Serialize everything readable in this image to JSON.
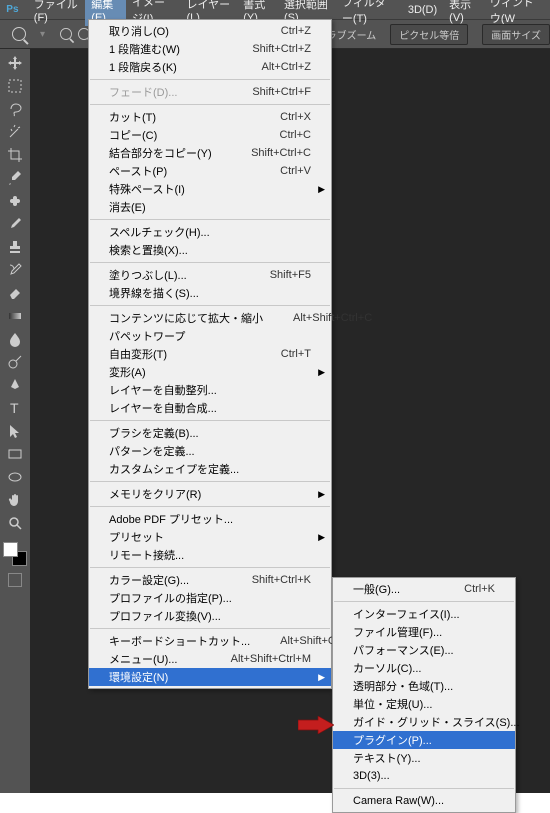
{
  "menubar": {
    "items": [
      "ファイル(F)",
      "編集(E)",
      "イメージ(I)",
      "レイヤー(L)",
      "書式(Y)",
      "選択範囲(S)",
      "フィルター(T)",
      "3D(D)",
      "表示(V)",
      "ウィンドウ(W"
    ]
  },
  "optionsbar": {
    "scrub_zoom": "スクラブズーム",
    "pixel_actual": "ピクセル等倍",
    "fit_screen": "画面サイズ"
  },
  "edit_menu": [
    {
      "label": "取り消し(O)",
      "accel": "Ctrl+Z"
    },
    {
      "label": "1 段階進む(W)",
      "accel": "Shift+Ctrl+Z"
    },
    {
      "label": "1 段階戻る(K)",
      "accel": "Alt+Ctrl+Z"
    },
    "sep",
    {
      "label": "フェード(D)...",
      "accel": "Shift+Ctrl+F",
      "disabled": true
    },
    "sep",
    {
      "label": "カット(T)",
      "accel": "Ctrl+X"
    },
    {
      "label": "コピー(C)",
      "accel": "Ctrl+C"
    },
    {
      "label": "結合部分をコピー(Y)",
      "accel": "Shift+Ctrl+C"
    },
    {
      "label": "ペースト(P)",
      "accel": "Ctrl+V"
    },
    {
      "label": "特殊ペースト(I)",
      "sub": true
    },
    {
      "label": "消去(E)"
    },
    "sep",
    {
      "label": "スペルチェック(H)..."
    },
    {
      "label": "検索と置換(X)..."
    },
    "sep",
    {
      "label": "塗りつぶし(L)...",
      "accel": "Shift+F5"
    },
    {
      "label": "境界線を描く(S)..."
    },
    "sep",
    {
      "label": "コンテンツに応じて拡大・縮小",
      "accel": "Alt+Shift+Ctrl+C"
    },
    {
      "label": "パペットワープ"
    },
    {
      "label": "自由変形(T)",
      "accel": "Ctrl+T"
    },
    {
      "label": "変形(A)",
      "sub": true
    },
    {
      "label": "レイヤーを自動整列..."
    },
    {
      "label": "レイヤーを自動合成..."
    },
    "sep",
    {
      "label": "ブラシを定義(B)..."
    },
    {
      "label": "パターンを定義..."
    },
    {
      "label": "カスタムシェイプを定義..."
    },
    "sep",
    {
      "label": "メモリをクリア(R)",
      "sub": true
    },
    "sep",
    {
      "label": "Adobe PDF プリセット..."
    },
    {
      "label": "プリセット",
      "sub": true
    },
    {
      "label": "リモート接続..."
    },
    "sep",
    {
      "label": "カラー設定(G)...",
      "accel": "Shift+Ctrl+K"
    },
    {
      "label": "プロファイルの指定(P)..."
    },
    {
      "label": "プロファイル変換(V)..."
    },
    "sep",
    {
      "label": "キーボードショートカット...",
      "accel": "Alt+Shift+Ctrl+K"
    },
    {
      "label": "メニュー(U)...",
      "accel": "Alt+Shift+Ctrl+M"
    },
    {
      "label": "環境設定(N)",
      "sub": true,
      "highlight": true
    }
  ],
  "prefs_menu": [
    {
      "label": "一般(G)...",
      "accel": "Ctrl+K"
    },
    "sep",
    {
      "label": "インターフェイス(I)..."
    },
    {
      "label": "ファイル管理(F)..."
    },
    {
      "label": "パフォーマンス(E)..."
    },
    {
      "label": "カーソル(C)..."
    },
    {
      "label": "透明部分・色域(T)..."
    },
    {
      "label": "単位・定規(U)..."
    },
    {
      "label": "ガイド・グリッド・スライス(S)..."
    },
    {
      "label": "プラグイン(P)...",
      "highlight": true
    },
    {
      "label": "テキスト(Y)..."
    },
    {
      "label": "3D(3)..."
    },
    "sep",
    {
      "label": "Camera Raw(W)..."
    }
  ],
  "tool_names": [
    "move",
    "marquee",
    "lasso",
    "wand",
    "crop",
    "eyedropper",
    "healing",
    "brush",
    "stamp",
    "history-brush",
    "eraser",
    "gradient",
    "blur",
    "dodge",
    "pen",
    "type",
    "path-select",
    "rectangle",
    "ellipse",
    "hand",
    "zoom"
  ]
}
